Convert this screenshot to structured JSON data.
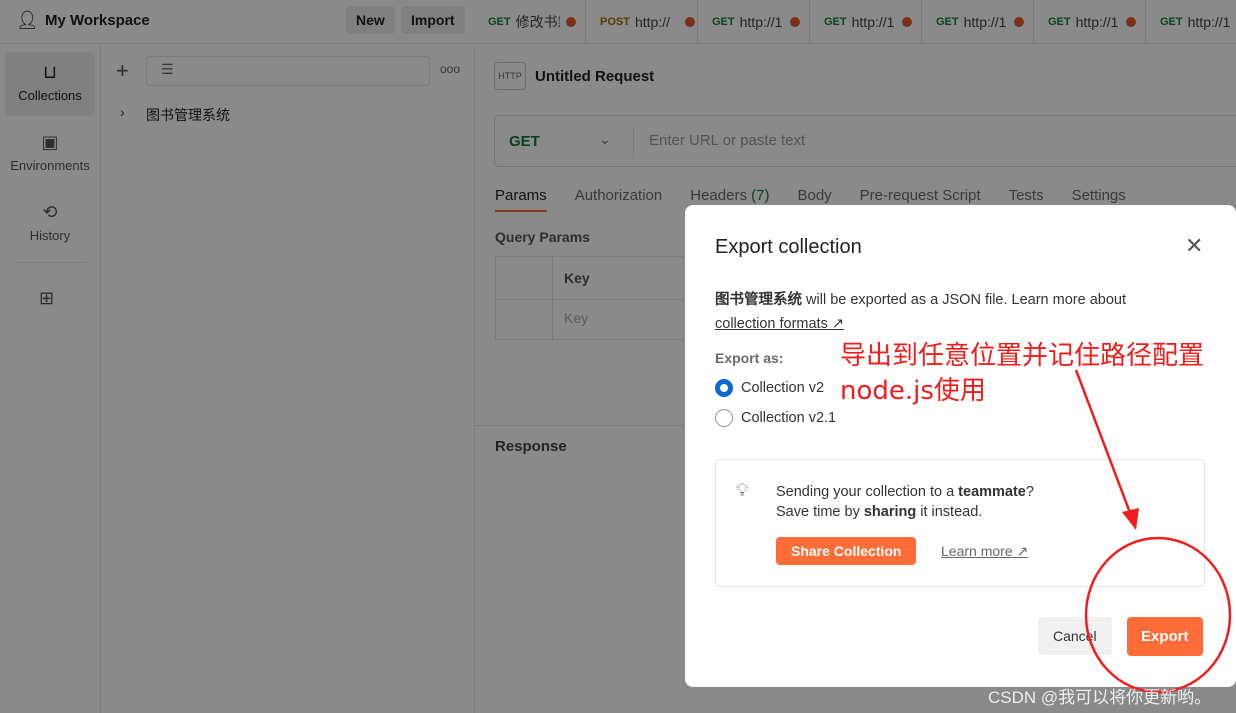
{
  "header": {
    "workspace": "My Workspace",
    "new_label": "New",
    "import_label": "Import"
  },
  "tabs": [
    {
      "method": "GET",
      "url": "修改书籍"
    },
    {
      "method": "POST",
      "url": "http://"
    },
    {
      "method": "GET",
      "url": "http://1"
    },
    {
      "method": "GET",
      "url": "http://1"
    },
    {
      "method": "GET",
      "url": "http://1"
    },
    {
      "method": "GET",
      "url": "http://1"
    },
    {
      "method": "GET",
      "url": "http://1"
    }
  ],
  "rail": [
    {
      "label": "Collections"
    },
    {
      "label": "Environments"
    },
    {
      "label": "History"
    }
  ],
  "sidebar": {
    "collection": "图书管理系统"
  },
  "request": {
    "title": "Untitled Request",
    "method": "GET",
    "url_placeholder": "Enter URL or paste text",
    "tabs": [
      "Params",
      "Authorization",
      "Headers",
      "Body",
      "Pre-request Script",
      "Tests",
      "Settings"
    ],
    "headers_count": "(7)",
    "query_params": "Query Params",
    "key_header": "Key",
    "key_placeholder": "Key",
    "response": "Response"
  },
  "modal": {
    "title": "Export collection",
    "collection_name": "图书管理系统",
    "desc": " will be exported as a JSON file. Learn more about",
    "link": "collection formats ↗",
    "export_as": "Export as:",
    "options": [
      "Collection v2",
      "Collection v2.1"
    ],
    "selected": "Collection v2",
    "tip_line1_a": "Sending your collection to a ",
    "tip_line1_b": "teammate",
    "tip_line1_c": "?",
    "tip_line2_a": "Save time by ",
    "tip_line2_b": "sharing",
    "tip_line2_c": " it instead.",
    "share_label": "Share Collection",
    "learn_more": "Learn more ↗",
    "cancel_label": "Cancel",
    "export_label": "Export"
  },
  "annotation": {
    "line1": "导出到任意位置并记住路径配置",
    "line2": "node.js使用"
  },
  "watermark": "CSDN @我可以将你更新哟。",
  "colors": {
    "accent": "#ff6c37",
    "annotation": "#f21c1c",
    "radio": "#0b6ad8"
  }
}
